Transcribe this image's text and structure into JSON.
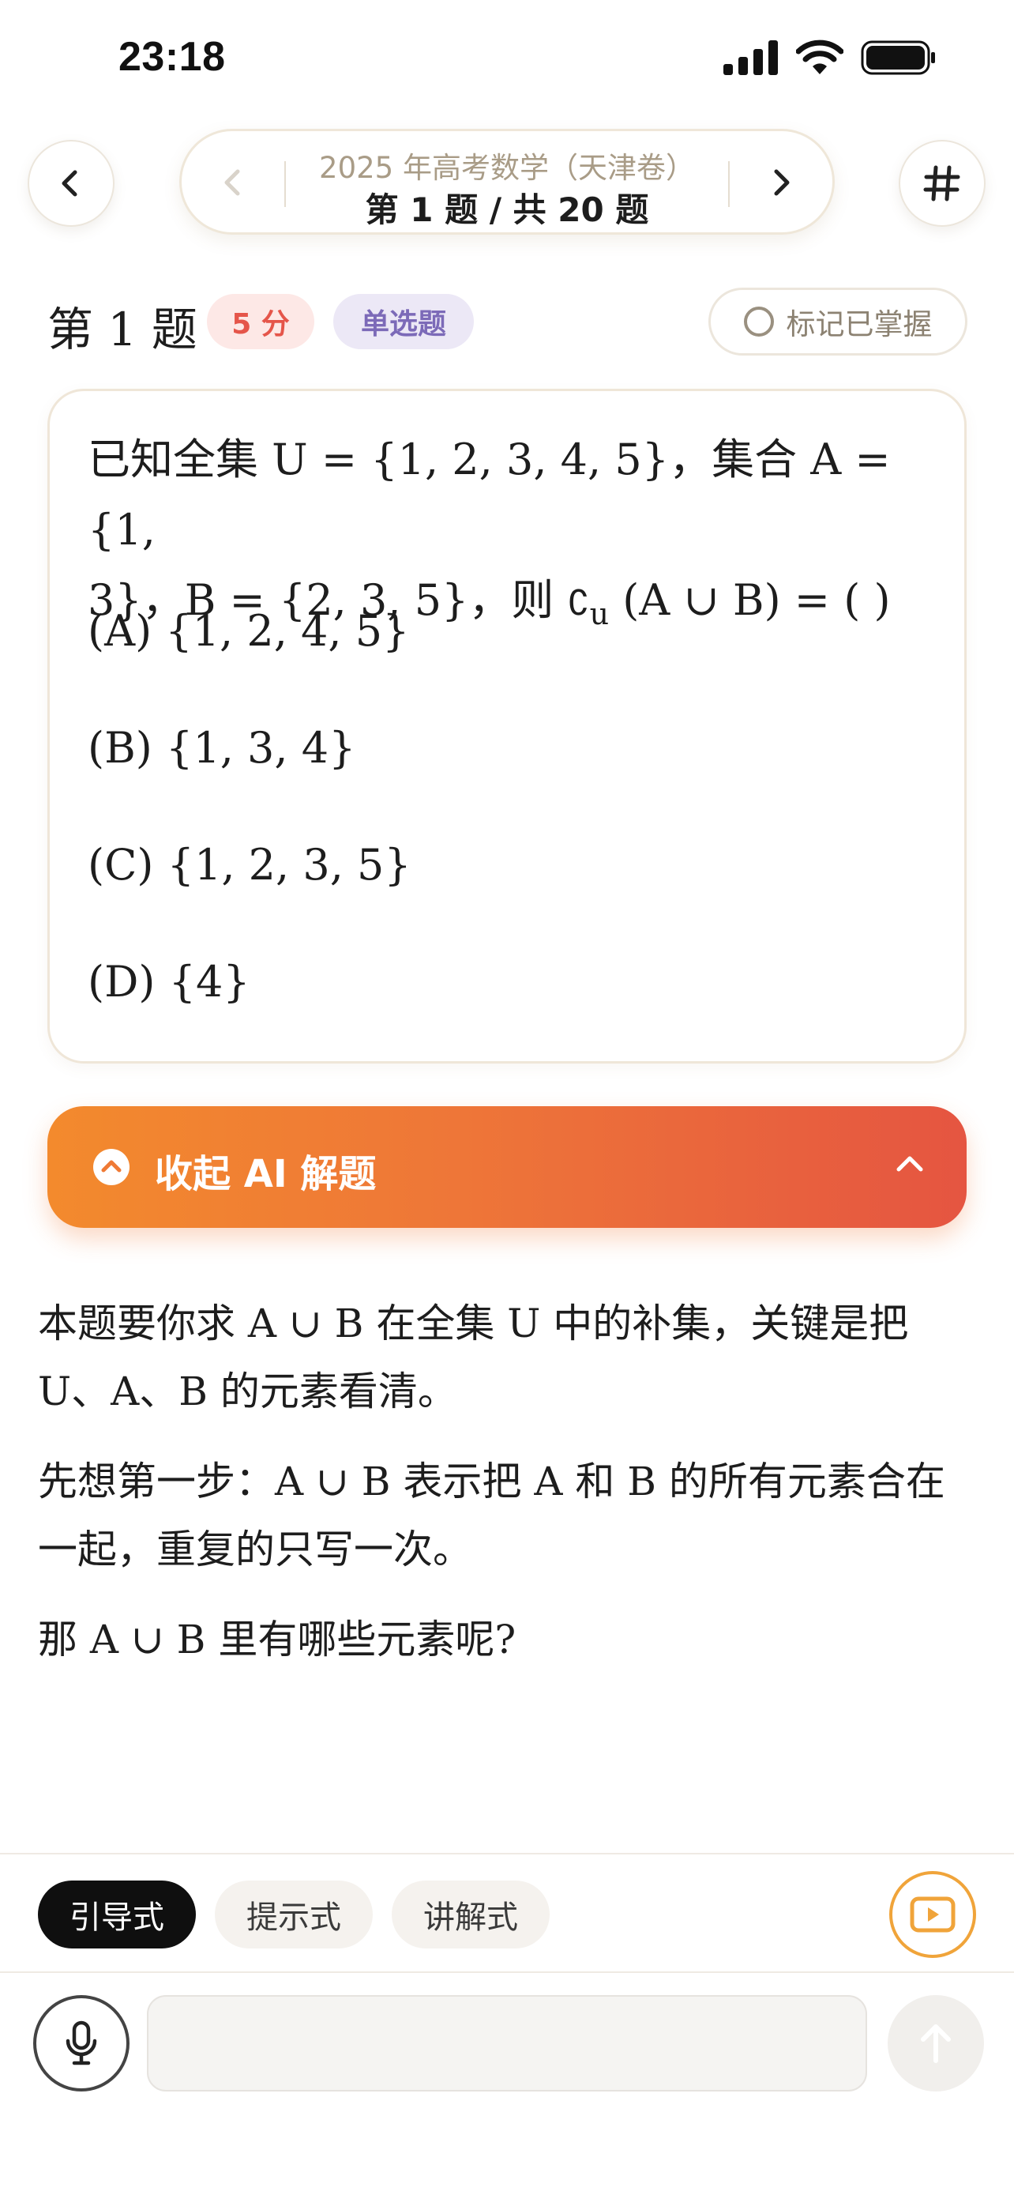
{
  "status_bar": {
    "time": "23:18"
  },
  "nav": {
    "subtitle": "2025 年高考数学（天津卷）",
    "title": "第 1 题 / 共 20 题"
  },
  "question": {
    "label": "第 1 题",
    "score": "5 分",
    "type": "单选题",
    "mark_label": "标记已掌握",
    "stem_line1": "已知全集 U = {1, 2, 3, 4, 5}，集合 A = {1,",
    "stem_line2_a": "3}，B = {2, 3, 5}，则 ",
    "stem_complement": "∁",
    "stem_sub": "u",
    "stem_line2_b": " (A ∪ B) = (      )",
    "options": [
      "(A) {1, 2, 4, 5}",
      "(B) {1, 3, 4}",
      "(C) {1, 2, 3, 5}",
      "(D) {4}"
    ]
  },
  "ai_panel": {
    "label": "收起 AI 解题"
  },
  "explanation": {
    "paragraphs": [
      "本题要你求 A ∪ B 在全集 U 中的补集，关键是把 U、A、B 的元素看清。",
      "先想第一步：A ∪ B 表示把 A 和 B 的所有元素合在一起，重复的只写一次。",
      "那 A ∪ B 里有哪些元素呢?"
    ]
  },
  "modes": [
    "引导式",
    "提示式",
    "讲解式"
  ],
  "chat": {
    "input_value": "",
    "placeholder": ""
  },
  "colors": {
    "accent_orange": "#f38a2d",
    "accent_red": "#e55541",
    "score_text": "#e5554a",
    "type_text": "#7c6ab8"
  }
}
